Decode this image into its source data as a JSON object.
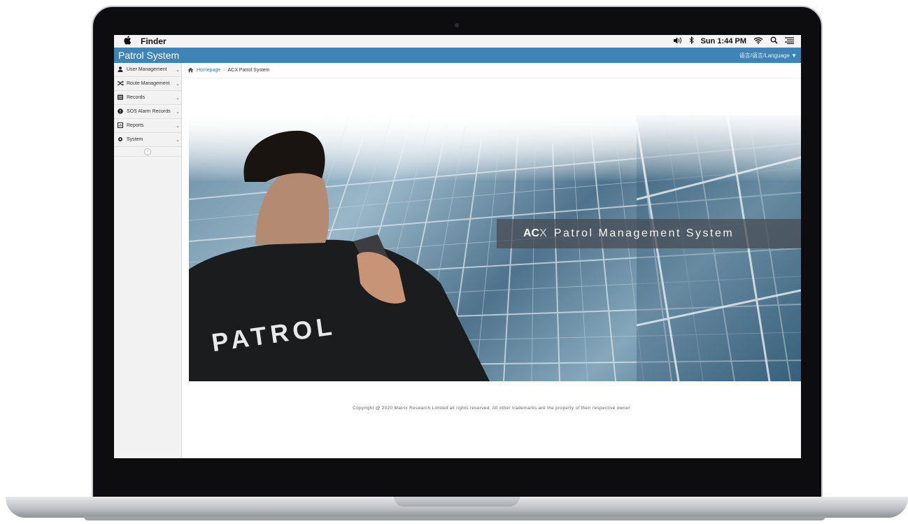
{
  "menubar": {
    "apple_icon": "apple-logo-icon",
    "app_name": "Finder",
    "clock": "Sun 1:44 PM",
    "icons": [
      "volume-icon",
      "bluetooth-icon",
      "wifi-icon",
      "spotlight-search-icon",
      "menu-list-icon"
    ]
  },
  "app": {
    "title": "Patrol System",
    "language_label": "语言/语言/Language",
    "language_caret": "▼",
    "accent_color": "#3f83b7"
  },
  "sidebar": {
    "items": [
      {
        "label": "User Management",
        "icon": "user-icon"
      },
      {
        "label": "Route Management",
        "icon": "shuffle-icon"
      },
      {
        "label": "Records",
        "icon": "records-icon"
      },
      {
        "label": "SOS Alarm Records",
        "icon": "alarm-icon"
      },
      {
        "label": "Reports",
        "icon": "report-icon"
      },
      {
        "label": "System",
        "icon": "system-icon"
      }
    ],
    "collapse_label": "‹"
  },
  "breadcrumb": {
    "home": "Homepage",
    "separator": "›",
    "current": "ACX Patrol System"
  },
  "hero": {
    "jacket_text": "PATROL",
    "caption_ac": "AC",
    "caption_x": "X",
    "caption_text": "Patrol Management System"
  },
  "footer": {
    "copyright": "Copyright @ 2020 Matrix Research Limited all rights reserved. All other trademarks are the property of their respective owner"
  }
}
